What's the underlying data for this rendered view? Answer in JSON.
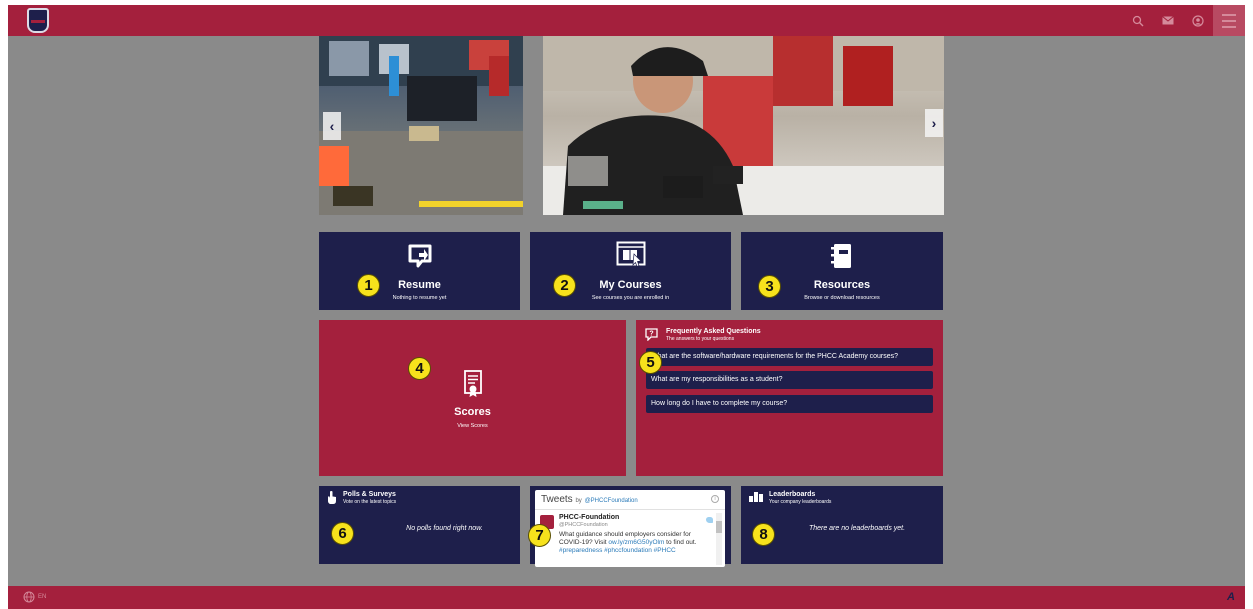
{
  "header": {
    "logo_name": "phcc-academy-logo",
    "icons": [
      "search-icon",
      "messages-icon",
      "user-account-icon",
      "menu-icon"
    ]
  },
  "carousel": {
    "prev_label": "‹",
    "next_label": "›"
  },
  "tiles": {
    "resume": {
      "title": "Resume",
      "subtitle": "Nothing to resume yet",
      "badge": "1"
    },
    "my_courses": {
      "title": "My Courses",
      "subtitle": "See courses you are enrolled in",
      "badge": "2"
    },
    "resources": {
      "title": "Resources",
      "subtitle": "Browse or download resources",
      "badge": "3"
    },
    "scores": {
      "title": "Scores",
      "subtitle": "View Scores",
      "badge": "4"
    }
  },
  "faq": {
    "title": "Frequently Asked Questions",
    "subtitle": "The answers to your questions",
    "badge": "5",
    "items": [
      "What are the software/hardware requirements for the PHCC Academy courses?",
      "What are my responsibilities as a student?",
      "How long do I have to complete my course?"
    ]
  },
  "polls": {
    "title": "Polls & Surveys",
    "subtitle": "Vote on the latest topics",
    "empty": "No polls found right now.",
    "badge": "6"
  },
  "tweets": {
    "header": "Tweets",
    "by": "by",
    "handle_link": "@PHCCFoundation",
    "badge": "7",
    "tweet": {
      "name": "PHCC-Foundation",
      "handle": "@PHCCFoundation",
      "text_before": "What guidance should employers consider for COVID-19? Visit ",
      "link": "ow.ly/zm6G50yOlm",
      "text_after": " to find out. ",
      "hashtags": "#preparedness #phccfoundation #PHCC"
    }
  },
  "leaderboards": {
    "title": "Leaderboards",
    "subtitle": "Your company leaderboards",
    "empty": "There are no leaderboards yet.",
    "badge": "8"
  },
  "footer": {
    "language": "EN",
    "brand_mark": "A"
  },
  "colors": {
    "crimson": "#a4203d",
    "navy": "#1e1f4b",
    "backdrop": "#8a8a8a",
    "badge": "#f7e21c"
  }
}
